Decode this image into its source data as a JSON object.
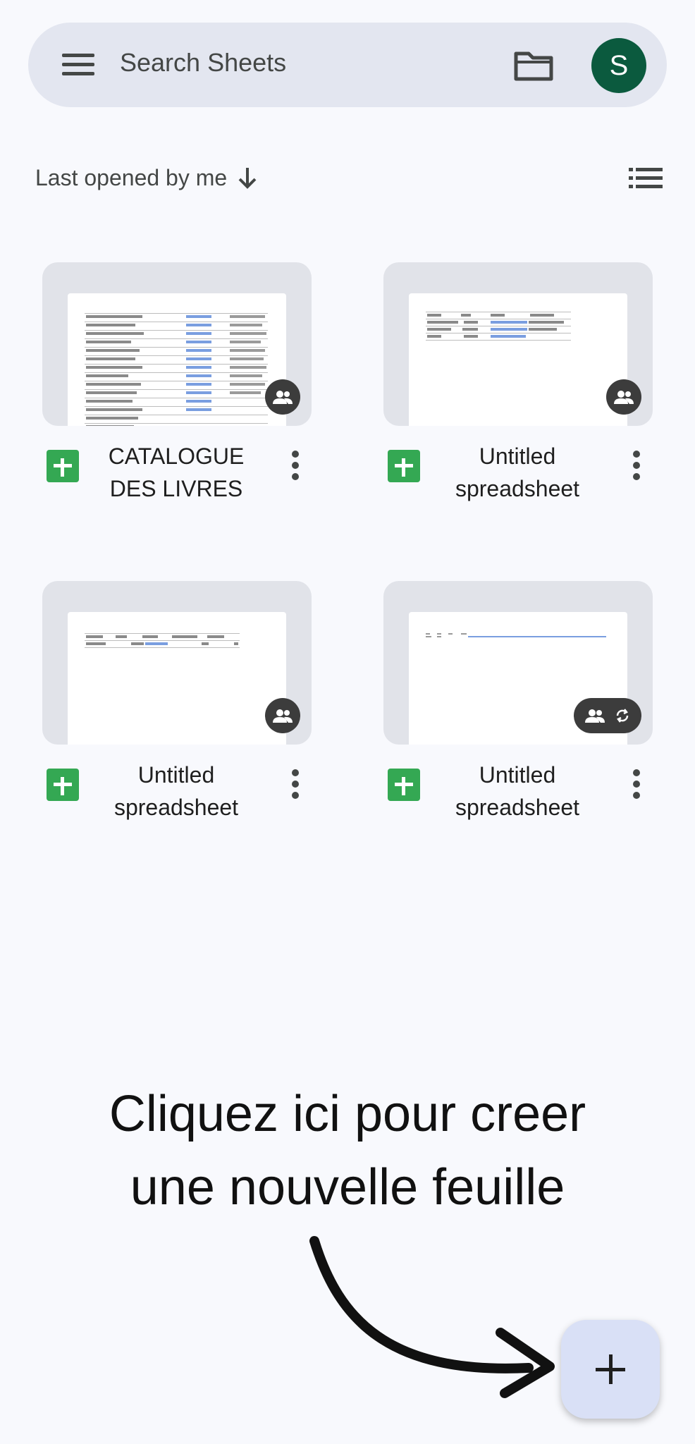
{
  "search": {
    "placeholder": "Search Sheets",
    "avatar_letter": "S"
  },
  "sort": {
    "label": "Last opened by me"
  },
  "files": [
    {
      "title": "CATALOGUE DES LIVRES",
      "badge": "shared"
    },
    {
      "title": "Untitled spreadsheet",
      "badge": "shared"
    },
    {
      "title": "Untitled spreadsheet",
      "badge": "shared"
    },
    {
      "title": "Untitled spreadsheet",
      "badge": "shared-sync"
    }
  ],
  "instruction": {
    "line1": "Cliquez ici pour creer",
    "line2": "une nouvelle feuille"
  },
  "fab": {
    "label": "+"
  },
  "colors": {
    "accent": "#0b5a3e",
    "sheets_green": "#34a853",
    "fab_bg": "#d9e0f6"
  }
}
